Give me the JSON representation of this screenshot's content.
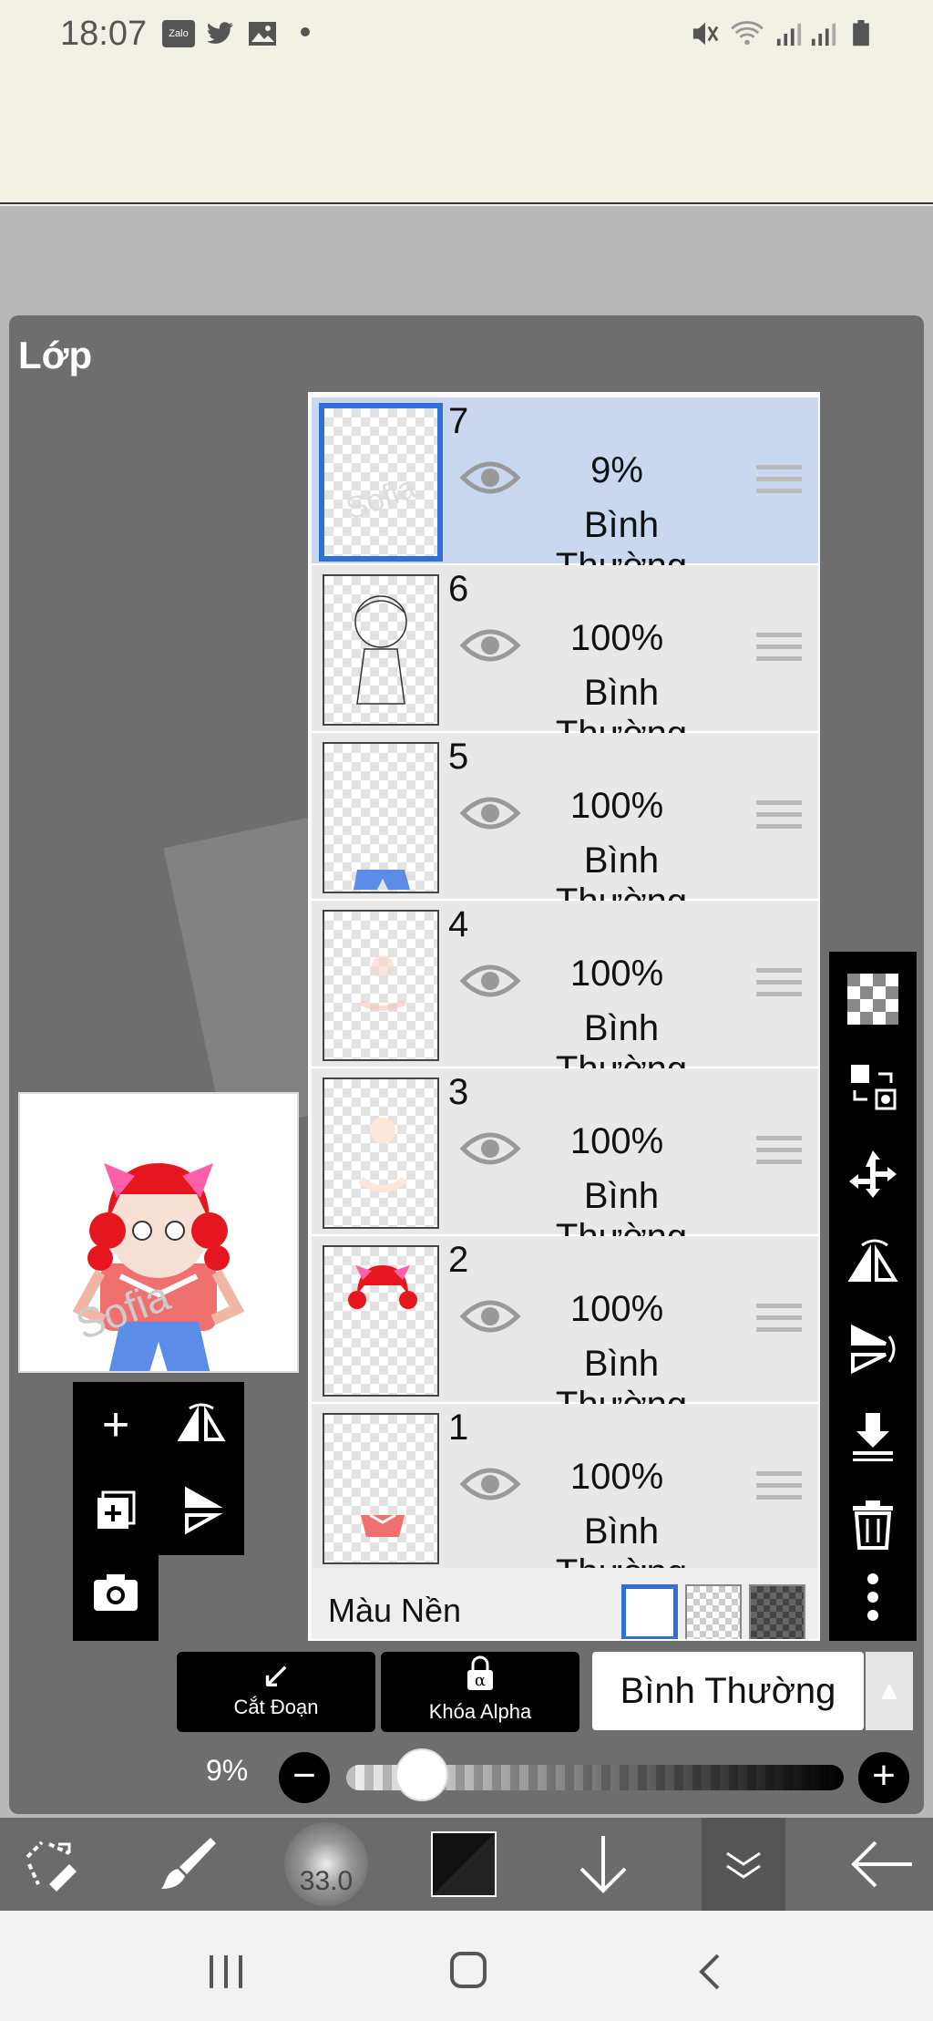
{
  "status_bar": {
    "time": "18:07",
    "notification_icons": [
      "zalo-icon",
      "twitter-icon",
      "image-icon",
      "dot-icon"
    ],
    "system_icons": [
      "mute-icon",
      "wifi-icon",
      "signal-icon",
      "signal-icon",
      "battery-icon"
    ],
    "zalo_label": "Zalo"
  },
  "panel": {
    "title": "Lớp"
  },
  "layers": [
    {
      "number": "7",
      "opacity": "9%",
      "blend": "Bình Thường",
      "selected": true
    },
    {
      "number": "6",
      "opacity": "100%",
      "blend": "Bình Thường",
      "selected": false
    },
    {
      "number": "5",
      "opacity": "100%",
      "blend": "Bình Thường",
      "selected": false
    },
    {
      "number": "4",
      "opacity": "100%",
      "blend": "Bình Thường",
      "selected": false
    },
    {
      "number": "3",
      "opacity": "100%",
      "blend": "Bình Thường",
      "selected": false
    },
    {
      "number": "2",
      "opacity": "100%",
      "blend": "Bình Thường",
      "selected": false
    },
    {
      "number": "1",
      "opacity": "100%",
      "blend": "Bình Thường",
      "selected": false
    }
  ],
  "background_row": {
    "label": "Màu Nền"
  },
  "left_tools": [
    "add-layer-icon",
    "flip-horizontal-icon",
    "add-layer-copy-icon",
    "flip-vertical-icon",
    "camera-icon"
  ],
  "right_tools": [
    "transparency-icon",
    "swap-layer-icon",
    "move-icon",
    "flip-horizontal-icon",
    "flip-vertical-icon",
    "merge-down-icon",
    "trash-icon",
    "more-icon"
  ],
  "bottom_controls": {
    "clip_label": "Cắt Đoạn",
    "alpha_lock_label": "Khóa Alpha",
    "blend_mode": "Bình Thường",
    "opacity_value": "9%",
    "opacity_fraction": 0.09
  },
  "app_bar": {
    "brush_size": "33.0",
    "items": [
      "select-transform-icon",
      "brush-icon",
      "brush-size-icon",
      "color-icon",
      "down-arrow-icon",
      "layers-icon",
      "back-arrow-icon"
    ]
  },
  "nav_bar": [
    "recent-apps-icon",
    "home-icon",
    "back-icon"
  ]
}
